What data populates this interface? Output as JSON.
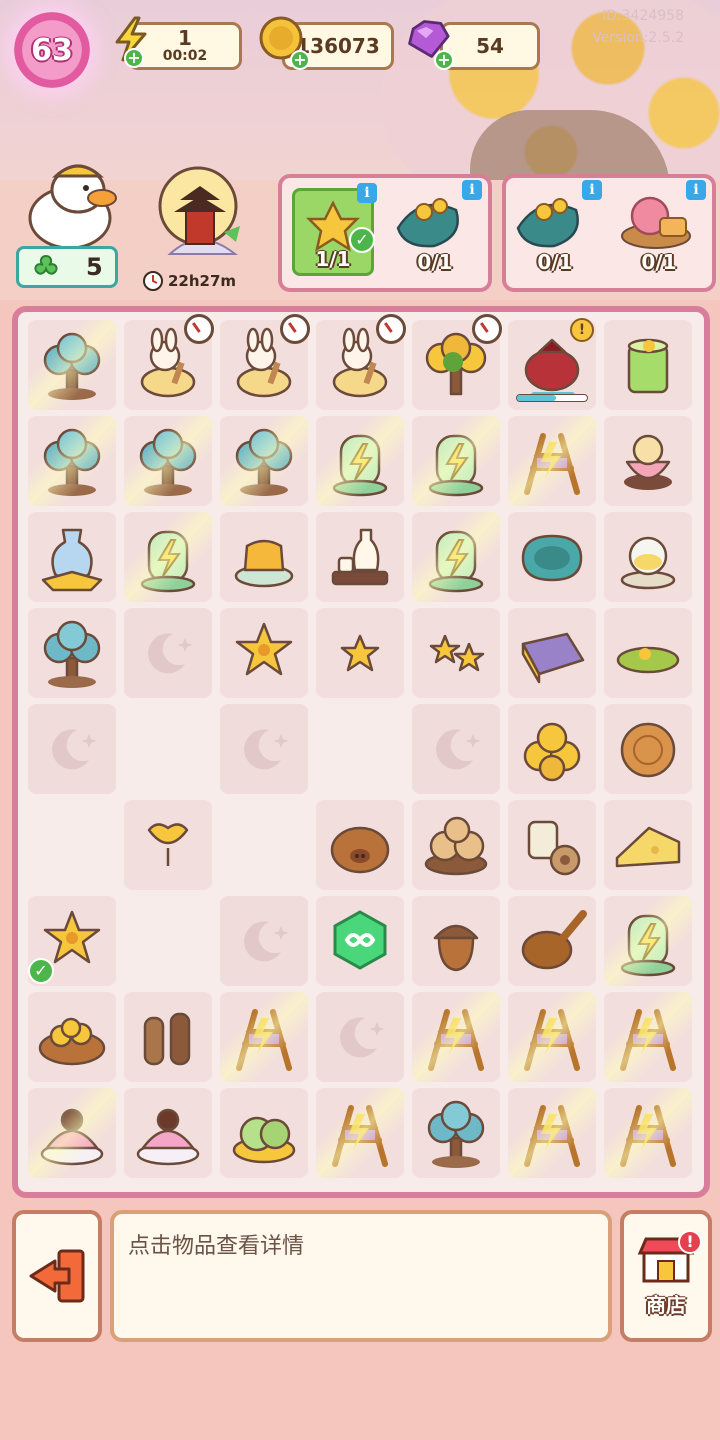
{
  "meta": {
    "id_text": "ID:3424958",
    "version_text": "Version:2.5.2"
  },
  "player": {
    "level": "63"
  },
  "resources": {
    "energy": {
      "value": "1",
      "timer": "00:02",
      "icon": "lightning-icon"
    },
    "coins": {
      "value": "136073",
      "icon": "coin-icon"
    },
    "gems": {
      "value": "54",
      "icon": "gem-icon"
    }
  },
  "helper": {
    "count": "5",
    "icon": "clover-icon"
  },
  "event": {
    "timer": "22h27m",
    "icon": "pagoda-moon-icon"
  },
  "orders": [
    {
      "slots": [
        {
          "item": "osmanthus-flower",
          "count": "1/1",
          "complete": true
        },
        {
          "item": "osmanthus-leaf-bundle",
          "count": "0/1",
          "complete": false
        }
      ]
    },
    {
      "slots": [
        {
          "item": "osmanthus-leaf-bundle",
          "count": "0/1",
          "complete": false
        },
        {
          "item": "rose-mooncake",
          "count": "0/1",
          "complete": false
        }
      ]
    }
  ],
  "board": {
    "rows": [
      [
        "lantern-tree",
        "bunny-mortar",
        "bunny-mortar",
        "bunny-bowl",
        "osmanthus-tree",
        "red-teapot",
        "green-drink"
      ],
      [
        "blue-tree",
        "blue-tree",
        "blue-tree",
        "energy-jar",
        "energy-jar",
        "loom",
        "peach-cake"
      ],
      [
        "blue-vase",
        "energy-jar",
        "jelly-cake",
        "sake-set",
        "energy-jar",
        "teal-plate",
        "glass-teapot"
      ],
      [
        "small-tree",
        "moon",
        "osmanthus-flower",
        "star-small",
        "star-double",
        "purple-cloth",
        "green-plate"
      ],
      [
        "moon",
        "empty",
        "moon",
        "empty",
        "moon",
        "gold-coins",
        "mooncake"
      ],
      [
        "empty",
        "ginkgo-leaf",
        "empty",
        "pig-bun",
        "bunny-buns",
        "thread-spool",
        "cheese-slice"
      ],
      [
        "osmanthus-branch",
        "empty",
        "moon",
        "infinity-gem",
        "acorn",
        "wood-spoon",
        "energy-jar"
      ],
      [
        "star-basket",
        "bark-bundle",
        "loom",
        "moon",
        "loom",
        "loom",
        "loom"
      ],
      [
        "cat-cake",
        "pink-cake",
        "green-mooncake",
        "loom",
        "bonsai-tree",
        "loom",
        "loom"
      ]
    ]
  },
  "bottom": {
    "info_text": "点击物品查看详情",
    "shop_label": "商店",
    "shop_alert": "!",
    "exit_icon": "exit-arrow-icon"
  }
}
